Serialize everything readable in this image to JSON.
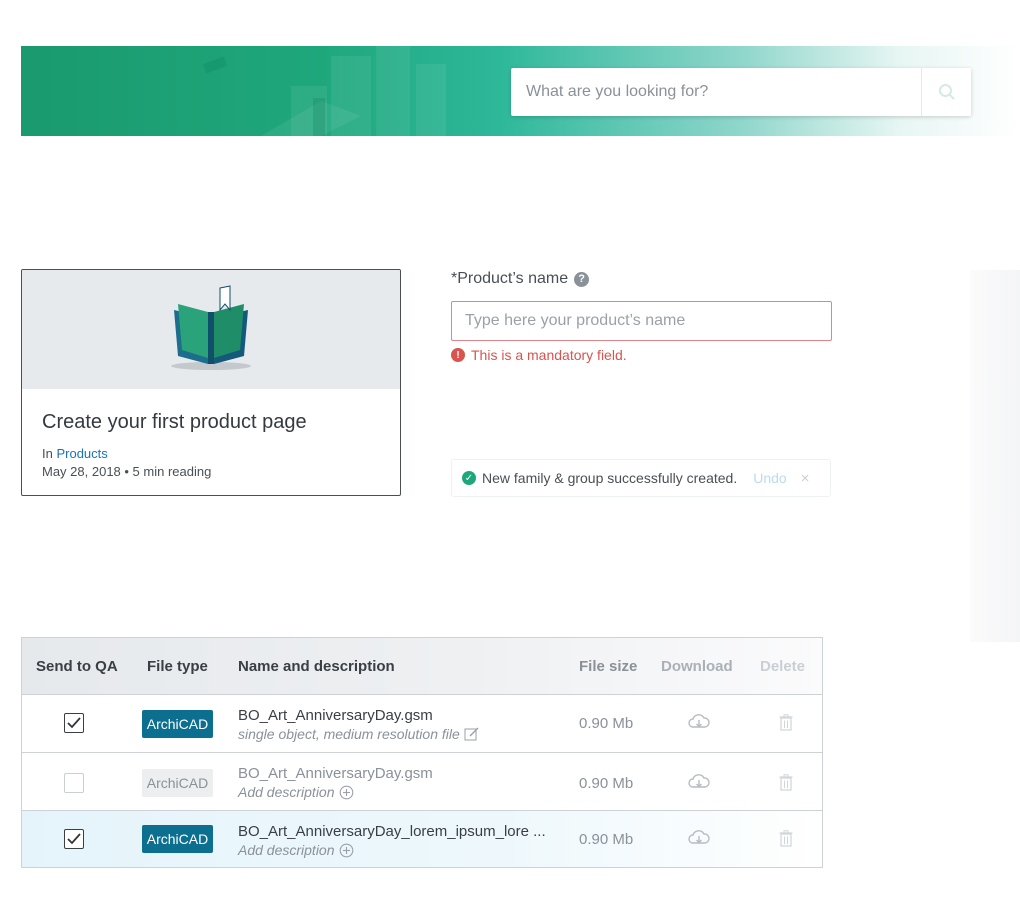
{
  "header": {
    "search_placeholder": "What are you looking for?"
  },
  "product_card": {
    "title": "Create your first product page",
    "category_prefix": "In",
    "category_link": "Products",
    "meta": "May 28, 2018 • 5 min reading",
    "illustration_icon": "open-book-icon"
  },
  "product_form": {
    "label": "*Product’s name",
    "input_placeholder": "Type here your product’s name",
    "error": "This is a mandatory field."
  },
  "toast": {
    "message": "New family & group successfully created.",
    "undo_label": "Undo",
    "close_label": "×"
  },
  "files_table": {
    "columns": [
      "Send to QA",
      "File type",
      "Name and description",
      "File size",
      "Download",
      "Delete"
    ],
    "rows": [
      {
        "checked": true,
        "file_type": "ArchiCAD",
        "name": "BO_Art_AnniversaryDay.gsm",
        "description": "single object, medium resolution file",
        "size": "0.90 Mb"
      },
      {
        "checked": false,
        "file_type": "ArchiCAD",
        "name": "BO_Art_AnniversaryDay.gsm",
        "description": "Add description",
        "size": "0.90 Mb"
      },
      {
        "checked": true,
        "file_type": "ArchiCAD",
        "name": "BO_Art_AnniversaryDay_lorem_ipsum_lore ...",
        "description": "Add description",
        "size": "0.90 Mb"
      }
    ]
  },
  "colors": {
    "brand_green": "#1fa77c",
    "badge_blue": "#0d6f8f",
    "error_red": "#d9534f",
    "link_blue": "#1a73b8"
  }
}
